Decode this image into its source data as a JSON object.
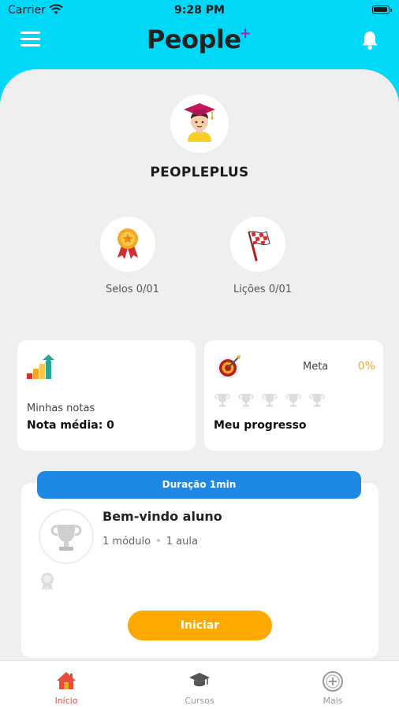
{
  "status_bar": {
    "carrier": "Carrier",
    "time": "9:28 PM"
  },
  "header": {
    "logo": "People",
    "logo_plus": "+"
  },
  "profile": {
    "username": "PEOPLEPLUS"
  },
  "stats": {
    "selos": "Selos 0/01",
    "licoes": "Lições 0/01"
  },
  "notas_card": {
    "label": "Minhas notas",
    "value": "Nota média: 0"
  },
  "progress_card": {
    "meta_label": "Meta",
    "meta_value": "0%",
    "title": "Meu progresso",
    "trophies_count": 5
  },
  "course": {
    "duration": "Duração 1min",
    "title": "Bem-vindo aluno",
    "modules": "1 módulo",
    "dot": "•",
    "lessons": "1 aula",
    "start_button": "Iniciar"
  },
  "bottom_nav": {
    "home": "Início",
    "cursos": "Cursos",
    "mais": "Mais"
  },
  "colors": {
    "header_bg": "#00D8F8",
    "panel_bg": "#EFEFEF",
    "accent_orange": "#FFA800",
    "duration_blue": "#1E88E5",
    "active_nav": "#E94B3C"
  }
}
